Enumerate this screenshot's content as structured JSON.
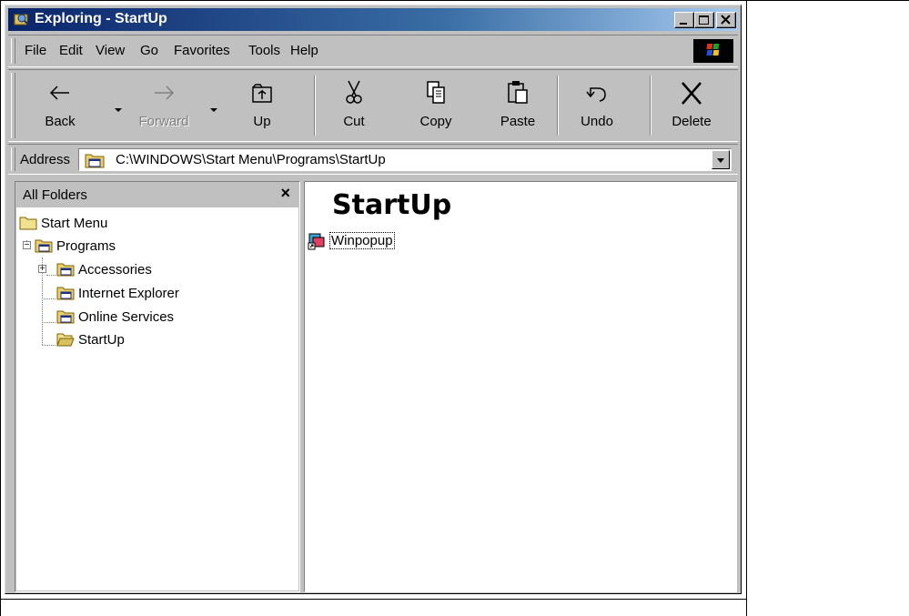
{
  "window": {
    "title": "Exploring - StartUp"
  },
  "menu": {
    "items": [
      {
        "label": "File"
      },
      {
        "label": "Edit"
      },
      {
        "label": "View"
      },
      {
        "label": "Go"
      },
      {
        "label": "Favorites"
      },
      {
        "label": "Tools"
      },
      {
        "label": "Help"
      }
    ]
  },
  "toolbar": {
    "buttons": [
      {
        "label": "Back",
        "icon": "back-arrow-icon",
        "enabled": true
      },
      {
        "label": "Forward",
        "icon": "forward-arrow-icon",
        "enabled": false
      },
      {
        "label": "Up",
        "icon": "up-folder-icon",
        "enabled": true
      },
      {
        "label": "Cut",
        "icon": "scissors-icon",
        "enabled": true
      },
      {
        "label": "Copy",
        "icon": "copy-icon",
        "enabled": true
      },
      {
        "label": "Paste",
        "icon": "paste-icon",
        "enabled": true
      },
      {
        "label": "Undo",
        "icon": "undo-icon",
        "enabled": true
      },
      {
        "label": "Delete",
        "icon": "delete-x-icon",
        "enabled": true
      }
    ]
  },
  "address": {
    "label": "Address",
    "value": "C:\\WINDOWS\\Start Menu\\Programs\\StartUp"
  },
  "folders_pane": {
    "title": "All Folders",
    "close": "×",
    "tree": [
      {
        "label": "Start Menu"
      },
      {
        "label": "Programs",
        "expander": "−"
      },
      {
        "label": "Accessories",
        "expander": "+"
      },
      {
        "label": "Internet Explorer"
      },
      {
        "label": "Online Services"
      },
      {
        "label": "StartUp"
      }
    ]
  },
  "content_pane": {
    "heading": "StartUp",
    "items": [
      {
        "label": "Winpopup"
      }
    ]
  },
  "colors": {
    "title_start": "#0a246a",
    "title_end": "#a6caf0",
    "face": "#c0c0c0"
  }
}
